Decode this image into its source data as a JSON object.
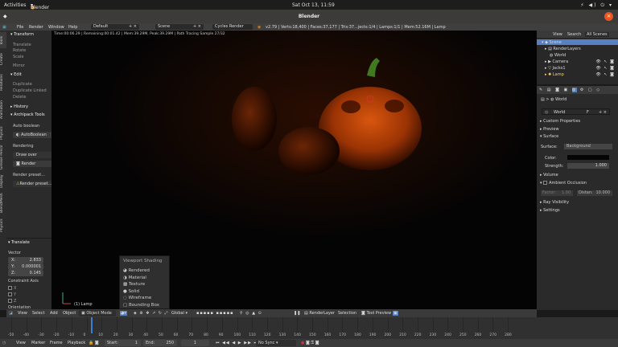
{
  "gnome": {
    "activities": "Activities",
    "app": "Blender",
    "clock": "Sat Oct 13, 11:59"
  },
  "window": {
    "title": "Blender",
    "close": "×"
  },
  "info": {
    "menus": [
      "File",
      "Render",
      "Window",
      "Help"
    ],
    "layout": "Default",
    "scene": "Scene",
    "engine": "Cycles Render",
    "stats": "v2.79 | Verts:18,400 | Faces:37,177 | Tris:37...jects:1/4 | Lamps:1/1 | Mem:52.16M | Lamp"
  },
  "tabs": [
    "Tools",
    "Create",
    "Relations",
    "Animation",
    "Physics",
    "Grease Pencil",
    "Display",
    "BlendMesh",
    "Physics"
  ],
  "shelf": {
    "transform_header": "Transform",
    "transform_items": [
      "Translate",
      "Rotate",
      "Scale",
      "Mirror"
    ],
    "edit_header": "Edit",
    "edit_items": [
      "Duplicate",
      "Duplicate Linked",
      "Delete"
    ],
    "history_header": "History",
    "archipack_header": "Archipack Tools",
    "archipack_items": [
      "Auto boolean",
      "AutoBoolean",
      "Rendering",
      "Draw over",
      "Render",
      "Render preset...",
      "Render preset..."
    ],
    "translate_header": "Translate",
    "vector_label": "Vector",
    "vector": [
      {
        "k": "X:",
        "v": "2.833"
      },
      {
        "k": "Y:",
        "v": "0.000001"
      },
      {
        "k": "Z:",
        "v": "0.145"
      }
    ],
    "constraint_label": "Constraint Axis",
    "constraint_axes": [
      "X",
      "Y",
      "Z"
    ],
    "orientation_label": "Orientation"
  },
  "viewport": {
    "status": "Time:00:06.29 | Remaining:00:01.42 | Mem:39.29M, Peak:39.29M | Path Tracing Sample 27/32",
    "object_label": "(1) Lamp",
    "shading_menu_title": "Viewport Shading",
    "shading_options": [
      "Rendered",
      "Material",
      "Texture",
      "Solid",
      "Wireframe",
      "Bounding Box"
    ]
  },
  "outliner": {
    "tabs": [
      "View",
      "Search",
      "All Scenes"
    ],
    "items": [
      "Scene",
      "RenderLayers",
      "World",
      "Camera",
      "Jacks1",
      "Lamp"
    ]
  },
  "props": {
    "world_name": "World",
    "world_field": "World",
    "world_users": "F",
    "sections": [
      "Custom Properties",
      "Preview",
      "Surface"
    ],
    "surface_label": "Surface:",
    "surface_value": "Background",
    "color_label": "Color:",
    "strength_label": "Strength:",
    "strength_value": "1.000",
    "more_sections": [
      "Volume",
      "Ambient Occlusion"
    ],
    "factor_label": "Factor:",
    "factor_value": "1.00",
    "distance_label": "Distan:",
    "distance_value": "10.000",
    "tail_sections": [
      "Ray Visibility",
      "Settings"
    ]
  },
  "vheader": {
    "menus": [
      "View",
      "Select",
      "Add",
      "Object"
    ],
    "mode": "Object Mode",
    "pivot": "Global",
    "layer": "RenderLayer",
    "selection": "Selection",
    "preview": "Tool Preview"
  },
  "timeline": {
    "ticks": [
      "-50",
      "-40",
      "-30",
      "-20",
      "-10",
      "0",
      "10",
      "20",
      "30",
      "40",
      "50",
      "60",
      "70",
      "80",
      "90",
      "100",
      "110",
      "120",
      "130",
      "140",
      "150",
      "160",
      "170",
      "180",
      "190",
      "200",
      "210",
      "220",
      "230",
      "240",
      "250",
      "260",
      "270",
      "280"
    ],
    "menus": [
      "View",
      "Marker",
      "Frame",
      "Playback"
    ],
    "start_label": "Start:",
    "start": "1",
    "end_label": "End:",
    "end": "250",
    "current": "1",
    "sync": "No Sync"
  },
  "colors": {
    "accent": "#e95420",
    "pumpkin": "#c64a08",
    "stem": "#3f7a1e",
    "selected": "#5680c2"
  }
}
